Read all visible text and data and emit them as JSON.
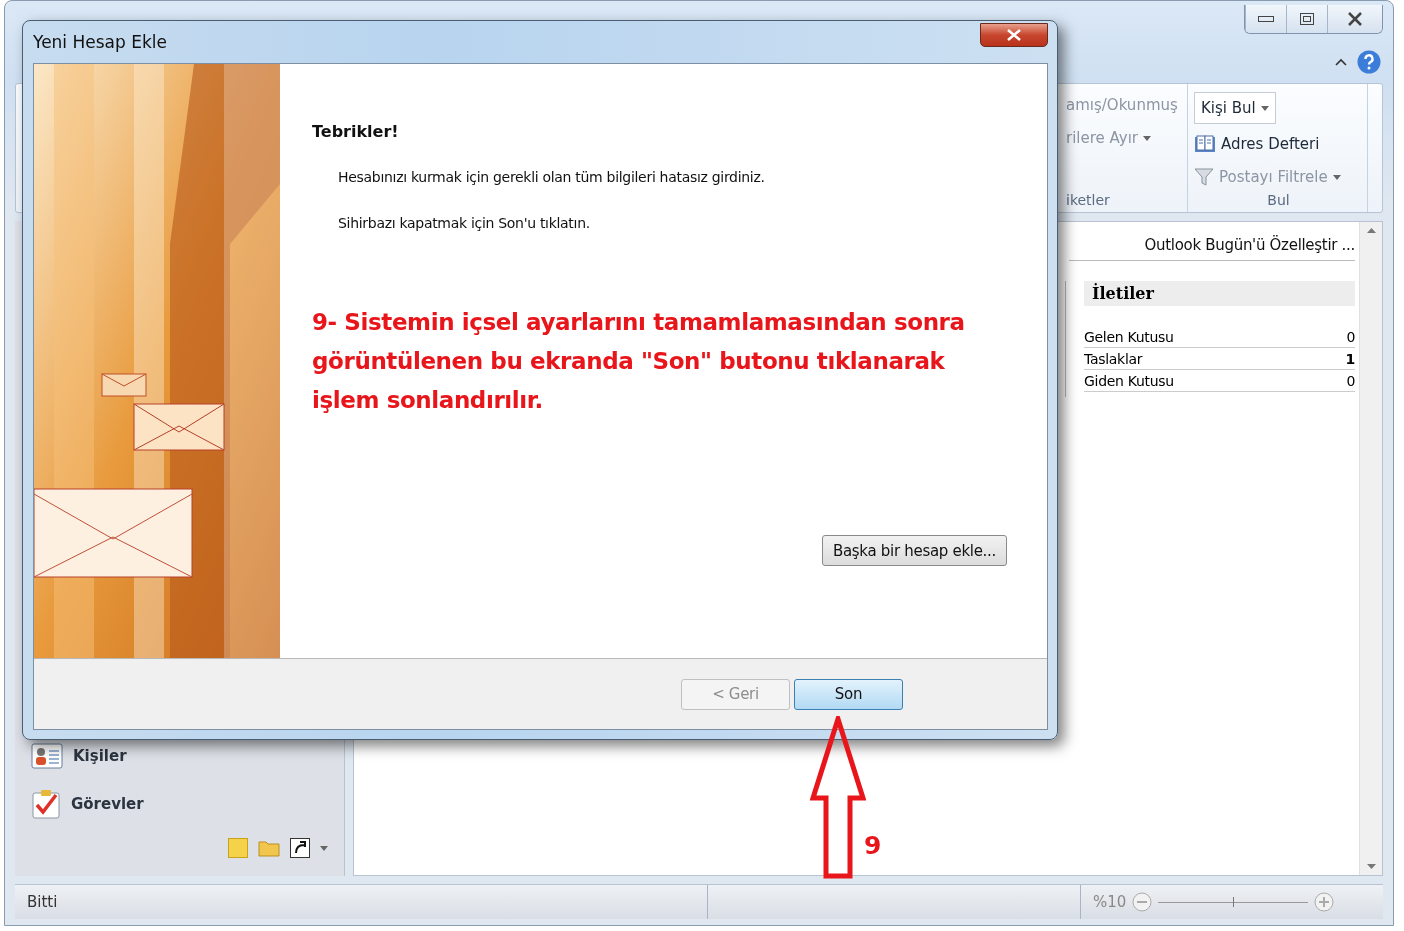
{
  "ribbon": {
    "groups": [
      {
        "label": "iketler",
        "items": [
          {
            "kind": "button",
            "label": "amış/Okunmuş",
            "disabled": true,
            "dropdown": false
          },
          {
            "kind": "button",
            "label": "rilere Ayır",
            "disabled": true,
            "dropdown": true
          }
        ]
      },
      {
        "label": "Bul",
        "items": [
          {
            "kind": "field",
            "label": "Kişi Bul",
            "disabled": false,
            "dropdown": true
          },
          {
            "kind": "book",
            "label": "Adres Defteri",
            "disabled": false,
            "dropdown": false
          },
          {
            "kind": "filter",
            "label": "Postayı Filtrele",
            "disabled": true,
            "dropdown": true
          }
        ]
      }
    ]
  },
  "outlook_today": {
    "customize_link": "Outlook Bugün'ü Özelleştir ...",
    "messages": {
      "title": "İletiler",
      "rows": [
        {
          "name": "Gelen Kutusu",
          "count": "0",
          "bold": false
        },
        {
          "name": "Taslaklar",
          "count": "1",
          "bold": true
        },
        {
          "name": "Giden Kutusu",
          "count": "0",
          "bold": false
        }
      ]
    }
  },
  "nav": {
    "items": [
      {
        "kind": "contacts",
        "label": "Kişiler"
      },
      {
        "kind": "tasks",
        "label": "Görevler"
      }
    ]
  },
  "status_bar": {
    "text": "Bitti",
    "zoom": "%10",
    "zoom_slider": {
      "level": 0.5
    }
  },
  "dialog": {
    "title": "Yeni Hesap Ekle",
    "heading": "Tebrikler!",
    "paragraphs": [
      "Hesabınızı kurmak için gerekli olan tüm bilgileri hatasız girdiniz.",
      "Sihirbazı kapatmak için Son'u tıklatın."
    ],
    "annotation": "9- Sistemin içsel ayarlarını tamamlamasından sonra görüntülenen bu ekranda \"Son\" butonu tıklanarak işlem sonlandırılır.",
    "add_account_button": "Başka bir hesap ekle...",
    "buttons": [
      {
        "label": "< Geri",
        "disabled": true,
        "selected": false
      },
      {
        "label": "Son",
        "disabled": false,
        "selected": true
      }
    ]
  },
  "callout": {
    "label": "9"
  }
}
